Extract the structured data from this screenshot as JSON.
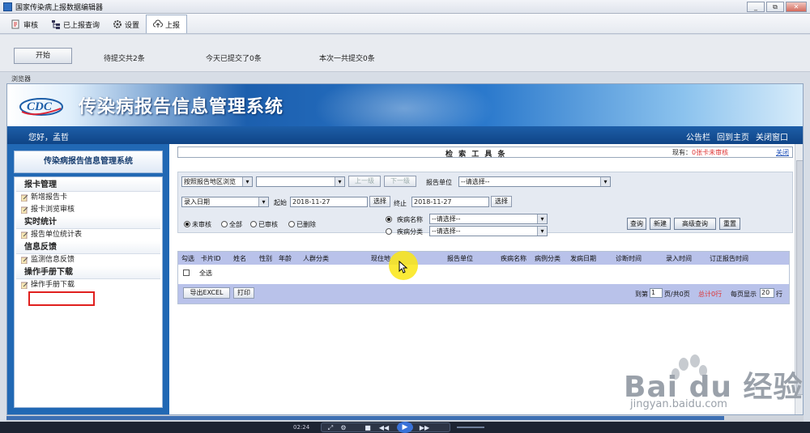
{
  "window": {
    "title": "国家传染病上报数据编辑器",
    "btn_min": "_",
    "btn_max": "⧉",
    "btn_close": "✕"
  },
  "toolbar": {
    "items": [
      {
        "label": "审核",
        "icon": "review-icon"
      },
      {
        "label": "已上报查询",
        "icon": "tree-icon"
      },
      {
        "label": "设置",
        "icon": "gear-icon"
      },
      {
        "label": "上报",
        "icon": "upload-cloud-icon"
      }
    ]
  },
  "status": {
    "start_label": "开始",
    "pending": "待提交共2条",
    "today": "今天已提交了0条",
    "total": "本次一共提交0条"
  },
  "browser_label": "浏览器",
  "site": {
    "title": "传染病报告信息管理系统",
    "logo_text": "CDC",
    "hello": "您好，孟哲",
    "links": [
      "公告栏",
      "回到主页",
      "关闭窗口"
    ]
  },
  "sidebar": {
    "title": "传染病报告信息管理系统",
    "sections": [
      {
        "title": "报卡管理",
        "items": [
          "新增报告卡",
          "报卡浏览审核"
        ]
      },
      {
        "title": "实时统计",
        "items": [
          "报告单位统计表"
        ]
      },
      {
        "title": "信息反馈",
        "items": [
          "监测信息反馈"
        ]
      },
      {
        "title": "操作手册下载",
        "items": [
          "操作手册下载"
        ]
      }
    ]
  },
  "search": {
    "toolbar_title": "检 索 工 具 条",
    "count_prefix": "现有：",
    "count_value": "0张卡未审核",
    "close": "关闭",
    "region_mode": "按照报告地区浏览",
    "region_value": "",
    "btn_up": "上一级",
    "btn_down": "下一级",
    "unit_label": "报告单位",
    "unit_value": "--请选择--",
    "date_type": "录入日期",
    "start_label": "起始",
    "start_date": "2018-11-27",
    "choose": "选择",
    "end_label": "终止",
    "end_date": "2018-11-27",
    "status_options": [
      "未审核",
      "全部",
      "已审核",
      "已删除"
    ],
    "disease_name_label": "疾病名称",
    "disease_name_value": "--请选择--",
    "disease_class_label": "疾病分类",
    "disease_class_value": "--请选择--",
    "buttons": [
      "查询",
      "新建",
      "高级查询",
      "重置"
    ]
  },
  "grid": {
    "columns": [
      "勾选",
      "卡片ID",
      "姓名",
      "性别",
      "年龄",
      "人群分类",
      "现住地",
      "报告单位",
      "疾病名称",
      "病例分类",
      "发病日期",
      "诊断时间",
      "录入时间",
      "订正报告时间"
    ],
    "select_all": "全选",
    "export": "导出EXCEL",
    "print": "打印",
    "page_prefix": "到第",
    "page_value": "1",
    "page_suffix": "页/共0页",
    "total": "总计0行",
    "per_page_prefix": "每页显示",
    "per_page_value": "20",
    "per_page_suffix": "行"
  },
  "player": {
    "time": "02:24"
  },
  "watermark": {
    "brand": "Bai du 经验",
    "url": "jingyan.baidu.com"
  }
}
